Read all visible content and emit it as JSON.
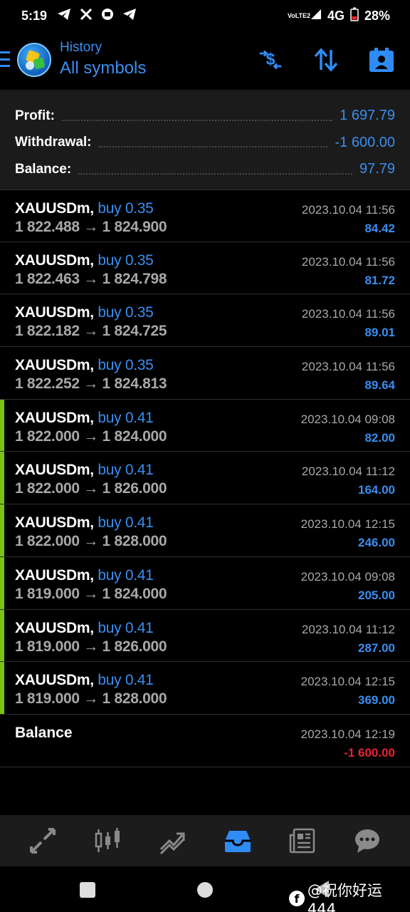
{
  "status_bar": {
    "time": "5:19",
    "network": "4G",
    "volte": "VoLTE2",
    "battery": "28%"
  },
  "header": {
    "label": "History",
    "title": "All symbols",
    "icons": [
      "currency-exchange-icon",
      "sort-icon",
      "calendar-icon"
    ]
  },
  "summary": {
    "profit_label": "Profit:",
    "profit_value": "1 697.79",
    "withdrawal_label": "Withdrawal:",
    "withdrawal_value": "-1 600.00",
    "balance_label": "Balance:",
    "balance_value": "97.79"
  },
  "trades": [
    {
      "symbol": "XAUUSDm,",
      "side": "buy 0.35",
      "open": "1 822.488",
      "close": "1 824.900",
      "datetime": "2023.10.04 11:56",
      "profit": "84.42",
      "marked": false
    },
    {
      "symbol": "XAUUSDm,",
      "side": "buy 0.35",
      "open": "1 822.463",
      "close": "1 824.798",
      "datetime": "2023.10.04 11:56",
      "profit": "81.72",
      "marked": false
    },
    {
      "symbol": "XAUUSDm,",
      "side": "buy 0.35",
      "open": "1 822.182",
      "close": "1 824.725",
      "datetime": "2023.10.04 11:56",
      "profit": "89.01",
      "marked": false
    },
    {
      "symbol": "XAUUSDm,",
      "side": "buy 0.35",
      "open": "1 822.252",
      "close": "1 824.813",
      "datetime": "2023.10.04 11:56",
      "profit": "89.64",
      "marked": false
    },
    {
      "symbol": "XAUUSDm,",
      "side": "buy 0.41",
      "open": "1 822.000",
      "close": "1 824.000",
      "datetime": "2023.10.04 09:08",
      "profit": "82.00",
      "marked": true
    },
    {
      "symbol": "XAUUSDm,",
      "side": "buy 0.41",
      "open": "1 822.000",
      "close": "1 826.000",
      "datetime": "2023.10.04 11:12",
      "profit": "164.00",
      "marked": true
    },
    {
      "symbol": "XAUUSDm,",
      "side": "buy 0.41",
      "open": "1 822.000",
      "close": "1 828.000",
      "datetime": "2023.10.04 12:15",
      "profit": "246.00",
      "marked": true
    },
    {
      "symbol": "XAUUSDm,",
      "side": "buy 0.41",
      "open": "1 819.000",
      "close": "1 824.000",
      "datetime": "2023.10.04 09:08",
      "profit": "205.00",
      "marked": true
    },
    {
      "symbol": "XAUUSDm,",
      "side": "buy 0.41",
      "open": "1 819.000",
      "close": "1 826.000",
      "datetime": "2023.10.04 11:12",
      "profit": "287.00",
      "marked": true
    },
    {
      "symbol": "XAUUSDm,",
      "side": "buy 0.41",
      "open": "1 819.000",
      "close": "1 828.000",
      "datetime": "2023.10.04 12:15",
      "profit": "369.00",
      "marked": true
    }
  ],
  "balance_entry": {
    "label": "Balance",
    "datetime": "2023.10.04 12:19",
    "amount": "-1 600.00"
  },
  "bottom_nav": [
    "quotes-icon",
    "chart-icon",
    "trade-icon",
    "history-icon",
    "news-icon",
    "chat-icon"
  ],
  "watermark": "@祝你好运444",
  "colors": {
    "accent": "#3a8ef0",
    "marker": "#7ac216",
    "negative": "#e8242e"
  }
}
